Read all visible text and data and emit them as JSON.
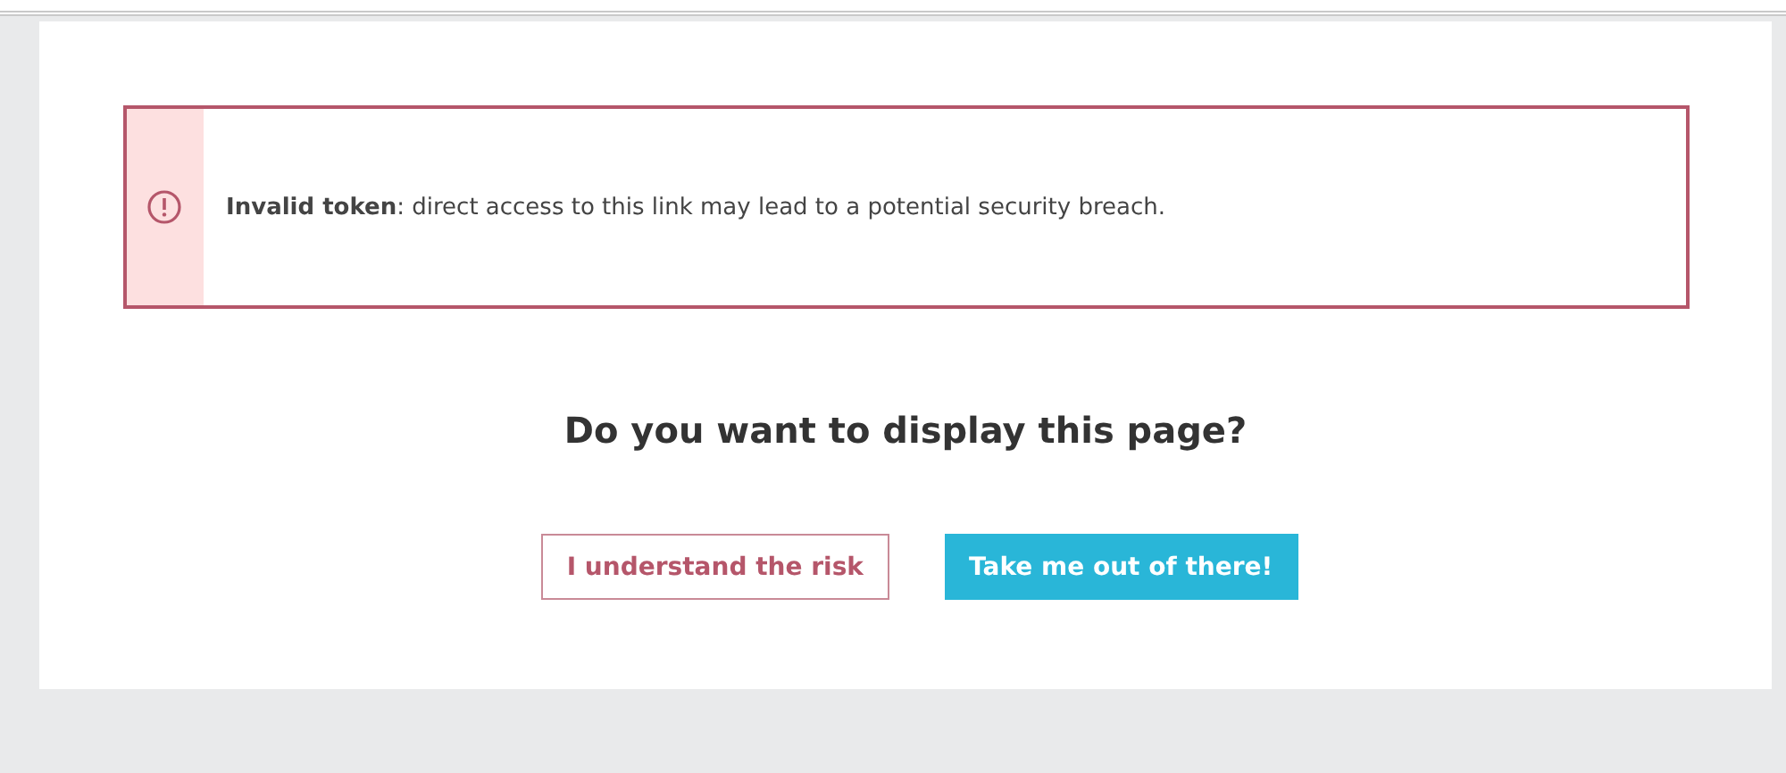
{
  "alert": {
    "message": "**Invalid token**: direct access to this link may lead to a potential security breach."
  },
  "question": "Do you want to display this page?",
  "buttons": [
    {
      "label": "I understand the risk",
      "kind": "outline"
    },
    {
      "label": "Take me out of there!",
      "kind": "primary"
    }
  ]
}
